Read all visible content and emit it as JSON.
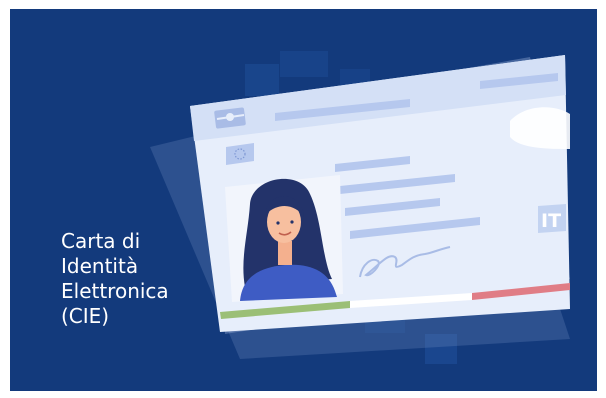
{
  "caption": {
    "lines": [
      "Carta di",
      "Identità",
      "Elettronica",
      "(CIE)"
    ]
  },
  "card": {
    "country_code": "IT"
  },
  "colors": {
    "background": "#133a7c",
    "card_face": "#e7eefb",
    "card_accent": "#b6c8ee",
    "stripe_green": "#9bbf76",
    "stripe_red": "#e07d86",
    "caption_text": "#ffffff"
  }
}
